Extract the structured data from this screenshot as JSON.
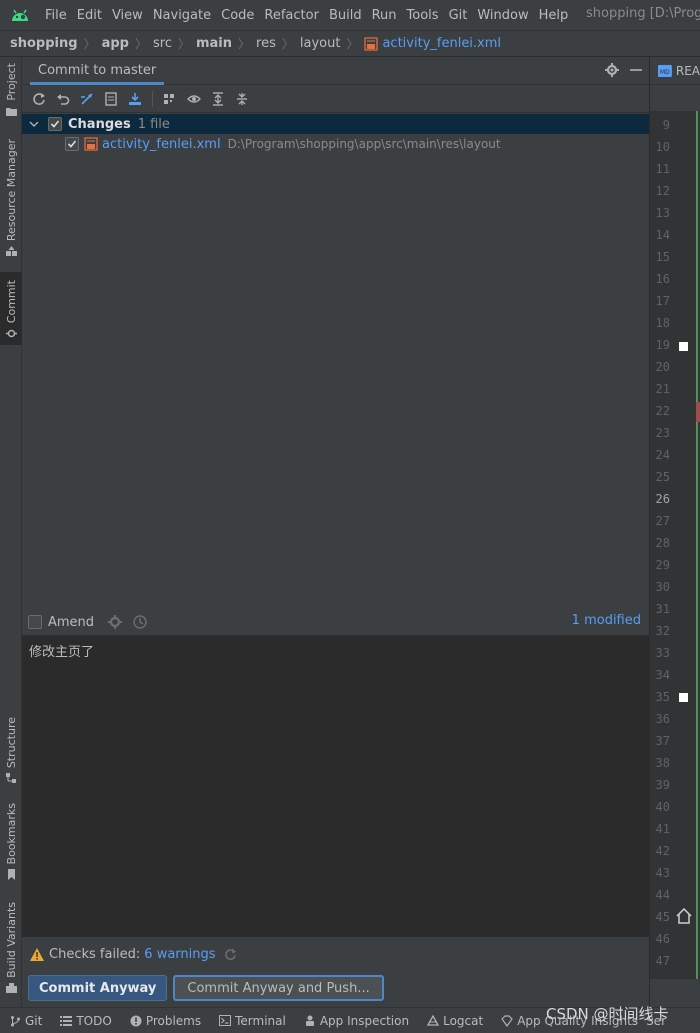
{
  "menubar": {
    "items": [
      "File",
      "Edit",
      "View",
      "Navigate",
      "Code",
      "Refactor",
      "Build",
      "Run",
      "Tools",
      "Git",
      "Window",
      "Help"
    ],
    "window_title": "shopping [D:\\Progr"
  },
  "breadcrumb": {
    "items": [
      "shopping",
      "app",
      "src",
      "main",
      "res",
      "layout"
    ],
    "file": "activity_fenlei.xml"
  },
  "left_tabs": {
    "project": "Project",
    "resource_manager": "Resource Manager",
    "commit": "Commit",
    "structure": "Structure",
    "bookmarks": "Bookmarks",
    "build_variants": "Build Variants"
  },
  "commit_panel": {
    "tab_label": "Commit to master",
    "changes_label": "Changes",
    "changes_count": "1 file",
    "file_name": "activity_fenlei.xml",
    "file_path": "D:\\Program\\shopping\\app\\src\\main\\res\\layout",
    "amend_label": "Amend",
    "modified_label": "1 modified",
    "commit_message": "修改主页了",
    "checks_failed_label": "Checks failed:",
    "checks_warnings": "6 warnings",
    "commit_button": "Commit Anyway",
    "commit_push_button": "Commit Anyway and Push..."
  },
  "editor": {
    "tab_label": "REA",
    "current_line": "26",
    "line_numbers": [
      "9",
      "10",
      "11",
      "12",
      "13",
      "14",
      "15",
      "16",
      "17",
      "18",
      "19",
      "20",
      "21",
      "22",
      "23",
      "24",
      "25",
      "26",
      "27",
      "28",
      "29",
      "30",
      "31",
      "32",
      "33",
      "34",
      "35",
      "36",
      "37",
      "38",
      "39",
      "40",
      "41",
      "42",
      "43",
      "44",
      "45",
      "46",
      "47"
    ]
  },
  "statusbar": {
    "items": [
      "Git",
      "TODO",
      "Problems",
      "Terminal",
      "App Inspection",
      "Logcat",
      "App Quality Insights",
      "Ser"
    ]
  },
  "watermark": "CSDN @时间线卡",
  "colors": {
    "accent": "#4a88c7",
    "link": "#589df6",
    "primary_button": "#365880",
    "selection": "#0d293e",
    "vcs_added": "#549159",
    "warning": "#f0a732"
  }
}
